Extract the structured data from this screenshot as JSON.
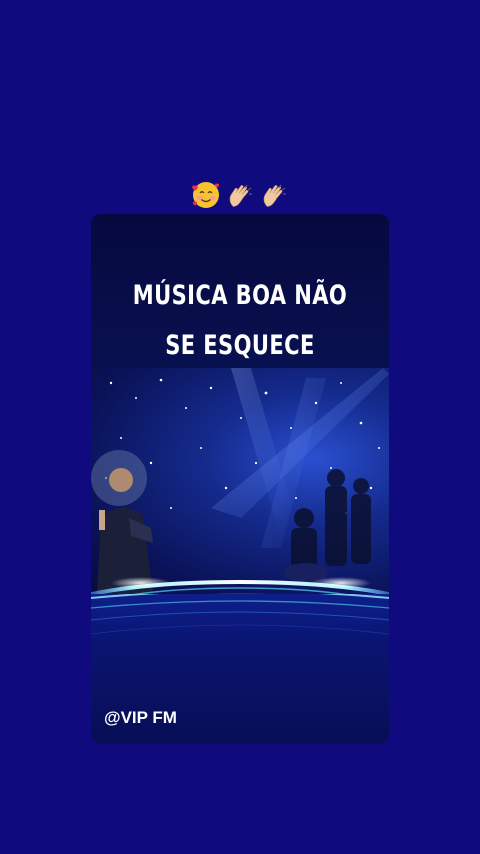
{
  "story": {
    "emojis": [
      "smiling-face-with-hearts-icon",
      "clapping-hands-icon",
      "clapping-hands-icon"
    ],
    "colors": {
      "background": "#0f0a7e",
      "card": "#070d4a",
      "stage_light": "#2a4fd0",
      "glow": "#5ad7ff"
    }
  },
  "card": {
    "title_line1": "MÚSICA BOA NÃO",
    "title_line2": "SE ESQUECE",
    "handle": "@VIP FM"
  }
}
